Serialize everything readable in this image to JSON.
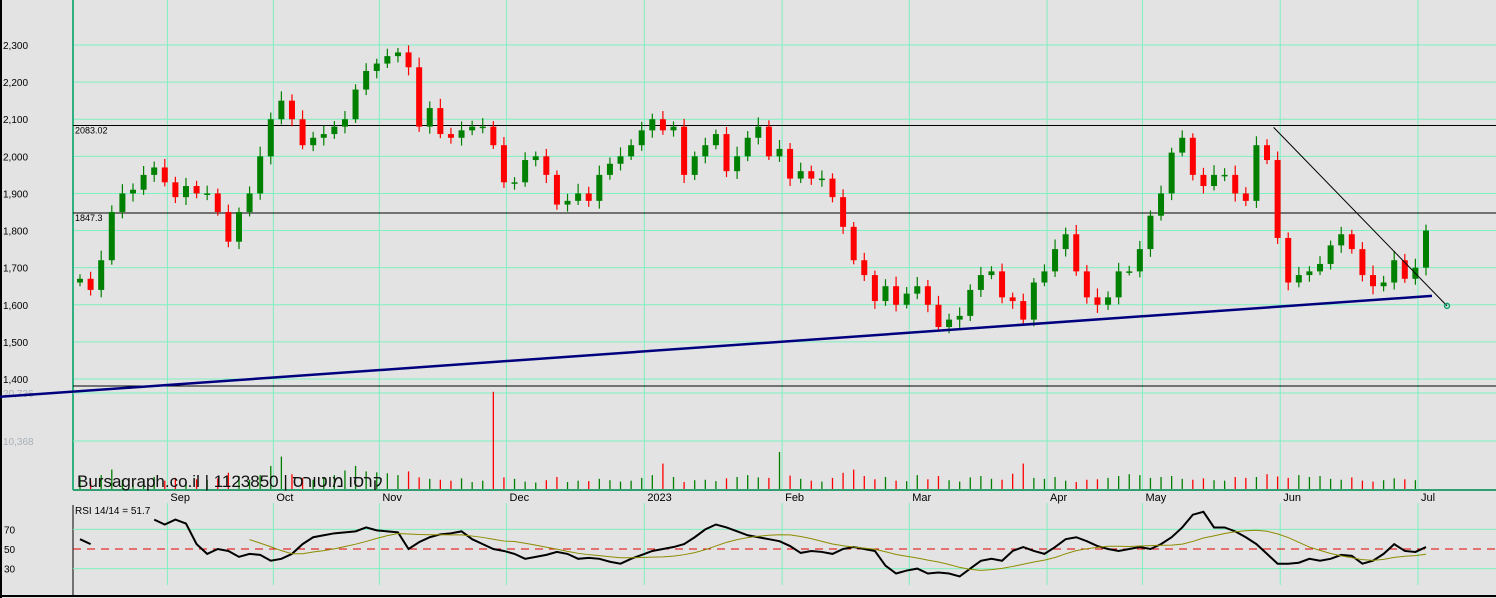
{
  "chart_data": {
    "type": "candlestick",
    "watermark": "Bursagraph.co.il | 1123850 | קרסו מוטורס",
    "ylim": [
      1400,
      2300
    ],
    "y_ticks": [
      "1,400",
      "1,500",
      "1,600",
      "1,700",
      "1,800",
      "1,900",
      "2,000",
      "2,100",
      "2,200",
      "2,300"
    ],
    "y_tick_values": [
      1400,
      1500,
      1600,
      1700,
      1800,
      1900,
      2000,
      2100,
      2200,
      2300
    ],
    "months": [
      "Sep",
      "Oct",
      "Nov",
      "Dec",
      "2023",
      "Feb",
      "Mar",
      "Apr",
      "May",
      "Jun",
      "Jul"
    ],
    "month_index": [
      9,
      19,
      29,
      41,
      54,
      67,
      79,
      92,
      101,
      114,
      127
    ],
    "levels": [
      {
        "label": "2083.02",
        "value": 2083.02
      },
      {
        "label": "1847.3",
        "value": 1847.3
      }
    ],
    "support_line": {
      "start": 1352,
      "end": 1624,
      "color": "#00007f"
    },
    "resistance_line": {
      "from_index": 113,
      "from": 2078,
      "to": 1597
    },
    "open_first": 1660,
    "closes": [
      1670,
      1640,
      1720,
      1850,
      1900,
      1910,
      1950,
      1970,
      1930,
      1890,
      1920,
      1900,
      1900,
      1850,
      1770,
      1850,
      1900,
      2000,
      2100,
      2150,
      2100,
      2030,
      2050,
      2060,
      2080,
      2100,
      2180,
      2230,
      2250,
      2270,
      2280,
      2240,
      2080,
      2130,
      2060,
      2050,
      2070,
      2080,
      2080,
      2030,
      1930,
      1930,
      1990,
      2000,
      1950,
      1870,
      1880,
      1900,
      1880,
      1950,
      1980,
      2000,
      2030,
      2070,
      2100,
      2070,
      2080,
      1950,
      2000,
      2030,
      2060,
      1960,
      2000,
      2050,
      2080,
      2000,
      2020,
      1940,
      1960,
      1940,
      1940,
      1890,
      1810,
      1720,
      1680,
      1610,
      1650,
      1600,
      1630,
      1650,
      1600,
      1540,
      1560,
      1570,
      1640,
      1680,
      1690,
      1620,
      1610,
      1560,
      1660,
      1690,
      1750,
      1790,
      1690,
      1620,
      1600,
      1620,
      1690,
      1690,
      1750,
      1840,
      1900,
      2010,
      2050,
      1950,
      1920,
      1950,
      1950,
      1900,
      1880,
      2030,
      1990,
      1780,
      1660,
      1680,
      1690,
      1710,
      1760,
      1790,
      1750,
      1680,
      1650,
      1660,
      1720,
      1670,
      1700,
      1800
    ],
    "volume_ticks": [
      {
        "label": "20,736",
        "value": 20736
      },
      {
        "label": "10,368",
        "value": 10368
      }
    ],
    "volume": [
      2500,
      1800,
      3000,
      4200,
      2000,
      1500,
      2200,
      2600,
      1800,
      2400,
      1600,
      2100,
      1900,
      2300,
      3500,
      2800,
      2000,
      3000,
      5000,
      7000,
      3200,
      2400,
      2000,
      2600,
      3000,
      4000,
      5000,
      3800,
      3600,
      3400,
      3000,
      3800,
      2500,
      2200,
      2000,
      1800,
      2300,
      1500,
      1800,
      21000,
      2500,
      2200,
      1600,
      1400,
      1900,
      2600,
      1500,
      1800,
      1700,
      2200,
      1900,
      1600,
      1800,
      2400,
      3000,
      5500,
      2600,
      1500,
      1900,
      2000,
      1700,
      2300,
      2600,
      3000,
      2500,
      2400,
      8000,
      2900,
      2200,
      1800,
      1600,
      2400,
      3500,
      4200,
      2800,
      2100,
      2600,
      1800,
      1700,
      3000,
      2100,
      2800,
      1900,
      1600,
      2500,
      2800,
      2200,
      2000,
      3300,
      5500,
      2400,
      2200,
      2600,
      1800,
      1500,
      2000,
      2100,
      2400,
      2800,
      3200,
      3000,
      2400,
      2600,
      2800,
      2200,
      2000,
      2300,
      1900,
      1800,
      2600,
      2400,
      2600,
      3200,
      2700,
      2400,
      3000,
      2600,
      2800,
      2200,
      2000,
      2500,
      1800,
      1600,
      1900,
      2300,
      2100,
      1900
    ],
    "rsi": {
      "label": "RSI 14/14 = 51.7",
      "ticks": [
        70,
        50,
        30
      ],
      "ylim": [
        20,
        90
      ],
      "reference": 50,
      "values": [
        60,
        55,
        null,
        null,
        null,
        null,
        null,
        80,
        75,
        80,
        76,
        55,
        45,
        50,
        48,
        42,
        45,
        44,
        38,
        40,
        45,
        55,
        62,
        64,
        66,
        67,
        68,
        72,
        69,
        68,
        67,
        50,
        57,
        62,
        65,
        66,
        68,
        60,
        55,
        50,
        48,
        45,
        40,
        42,
        44,
        47,
        45,
        40,
        41,
        40,
        37,
        35,
        40,
        44,
        48,
        50,
        52,
        55,
        62,
        70,
        75,
        72,
        68,
        64,
        62,
        60,
        58,
        53,
        46,
        48,
        47,
        45,
        50,
        52,
        50,
        48,
        33,
        25,
        28,
        30,
        25,
        26,
        25,
        22,
        30,
        38,
        40,
        38,
        48,
        52,
        48,
        45,
        52,
        60,
        62,
        58,
        53,
        50,
        48,
        50,
        52,
        50,
        55,
        62,
        72,
        85,
        88,
        72,
        72,
        68,
        62,
        55,
        45,
        35,
        35,
        36,
        40,
        38,
        40,
        44,
        43,
        35,
        38,
        45,
        55,
        48,
        47,
        52
      ]
    },
    "colors": {
      "up": "#008000",
      "down": "#ff0000",
      "grid": "#7ff0c0",
      "rsi": "#000000",
      "rsi_ma": "#8c8c00",
      "ref": "#e00000"
    }
  }
}
